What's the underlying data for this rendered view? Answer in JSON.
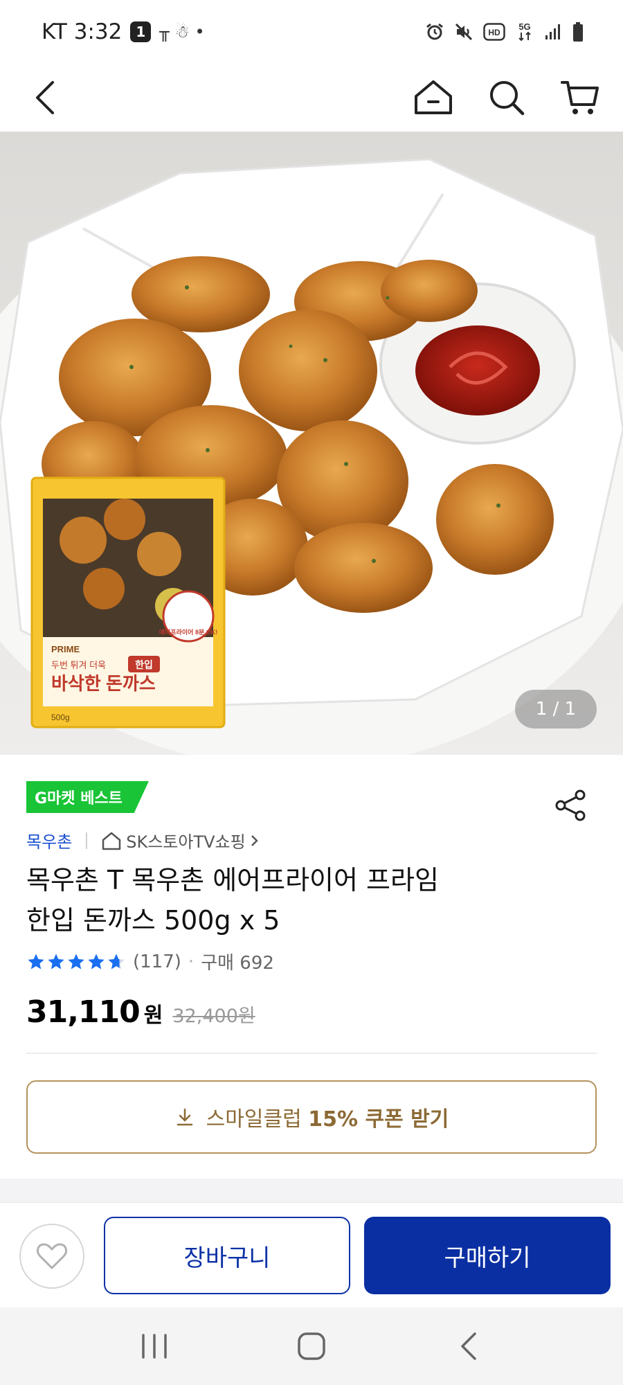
{
  "status_bar": {
    "carrier_time": "KT 3:32",
    "notification_count": "1",
    "extra_glyphs": "╥ ☃ •",
    "icons": [
      "alarm-icon",
      "mute-icon",
      "hd-voice-icon",
      "5g-icon",
      "signal-icon",
      "battery-icon"
    ],
    "hd_label": "HD",
    "network_label": "5G"
  },
  "top_nav": {
    "icons": [
      "back-icon",
      "home-icon",
      "search-icon",
      "cart-icon"
    ]
  },
  "product_image": {
    "counter": "1 / 1",
    "package_text": {
      "brand": "PRIME",
      "tagline": "두번 튀겨 더욱",
      "badge": "한입",
      "name": "바삭한 돈까스",
      "airfryer_badge": "에어프라이어 8분 OK!",
      "weight": "500g"
    }
  },
  "product": {
    "best_badge": "G마켓 베스트",
    "brand": "목우촌",
    "store": "SK스토아TV쇼핑",
    "title_line1": "목우촌 T 목우촌 에어프라이어 프라임",
    "title_line2": "한입 돈까스 500g x 5",
    "rating": 4.5,
    "review_count": "(117)",
    "purchase_count": "구매 692",
    "price": "31,110",
    "price_unit": "원",
    "original_price": "32,400원"
  },
  "coupon": {
    "label_prefix": "스마일클럽",
    "label_strong": "15% 쿠폰 받기"
  },
  "action_bar": {
    "cart_label": "장바구니",
    "buy_label": "구매하기"
  },
  "colors": {
    "primary_blue": "#0a2fa3",
    "link_blue": "#1b4fd0",
    "best_green": "#19c436",
    "coupon_gold": "#b5925e",
    "star_blue": "#1a6ff0"
  }
}
